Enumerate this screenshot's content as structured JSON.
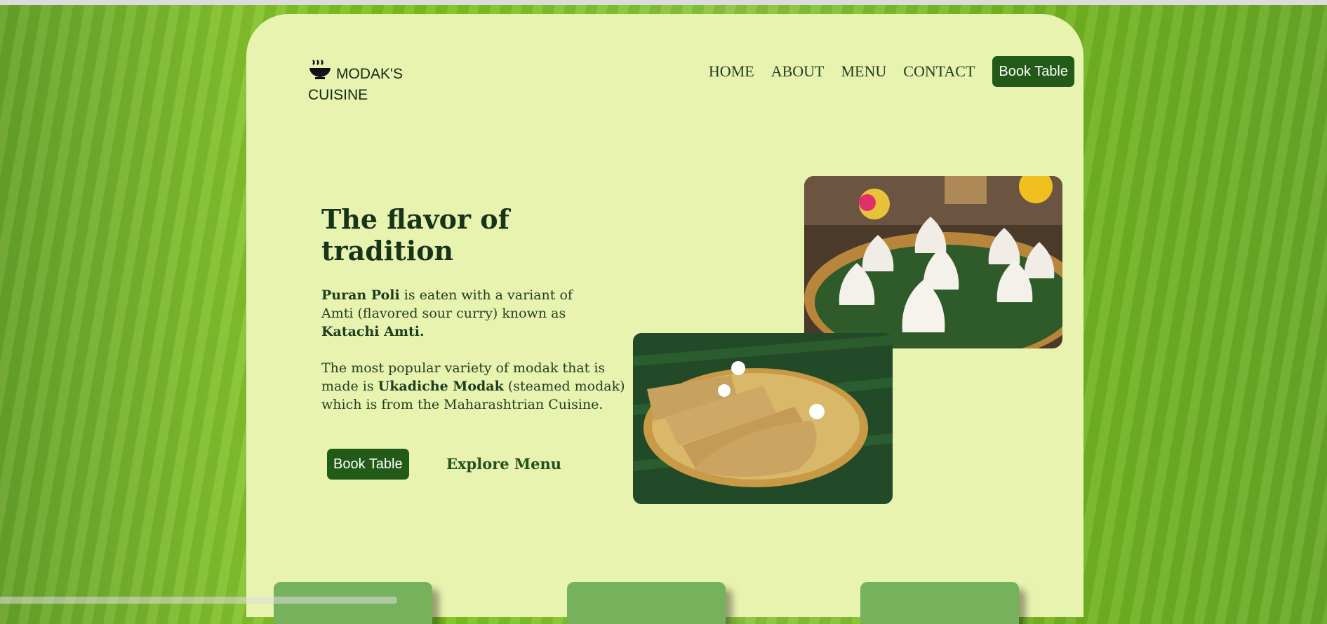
{
  "brand": {
    "name": "MODAK'S CUISINE",
    "icon": "food-bowl-icon"
  },
  "nav": {
    "links": [
      "HOME",
      "ABOUT",
      "MENU",
      "CONTACT"
    ],
    "book_label": "Book Table"
  },
  "hero": {
    "title": "The flavor of tradition",
    "p1": {
      "b1": "Puran Poli",
      "t1": " is eaten with a variant of Amti (flavored sour curry) known as ",
      "b2": "Katachi Amti."
    },
    "p2": {
      "t1": "The most popular variety of modak that is made is ",
      "b1": "Ukadiche Modak",
      "t2": " (steamed modak) which is from the Maharashtrian Cuisine."
    },
    "book_label": "Book Table",
    "explore_label": "Explore Menu"
  },
  "images": {
    "modak": "modak-photo",
    "poli": "puran-poli-photo"
  },
  "colors": {
    "accent": "#225a17",
    "card_bg": "#e8f3b0",
    "tile": "#76b15c"
  }
}
